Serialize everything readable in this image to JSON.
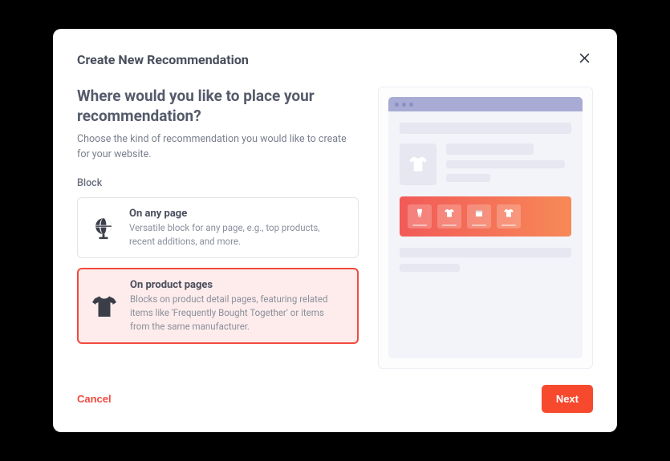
{
  "modal": {
    "title": "Create New Recommendation",
    "heading": "Where would you like to place your recommendation?",
    "subtext": "Choose the kind of recommendation you would like to create for your website.",
    "block_label": "Block",
    "cancel": "Cancel",
    "next": "Next"
  },
  "options": [
    {
      "id": "any-page",
      "title": "On any page",
      "desc": "Versatile block for any page, e.g., top products, recent additions, and more.",
      "icon": "globe",
      "selected": false
    },
    {
      "id": "product-pages",
      "title": "On product pages",
      "desc": "Blocks on product detail pages, featuring related items like 'Frequently Bought Together' or items from the same manufacturer.",
      "icon": "tshirt",
      "selected": true
    }
  ],
  "preview": {
    "reco_icons": [
      "pants",
      "tshirt",
      "box",
      "tshirt"
    ]
  }
}
